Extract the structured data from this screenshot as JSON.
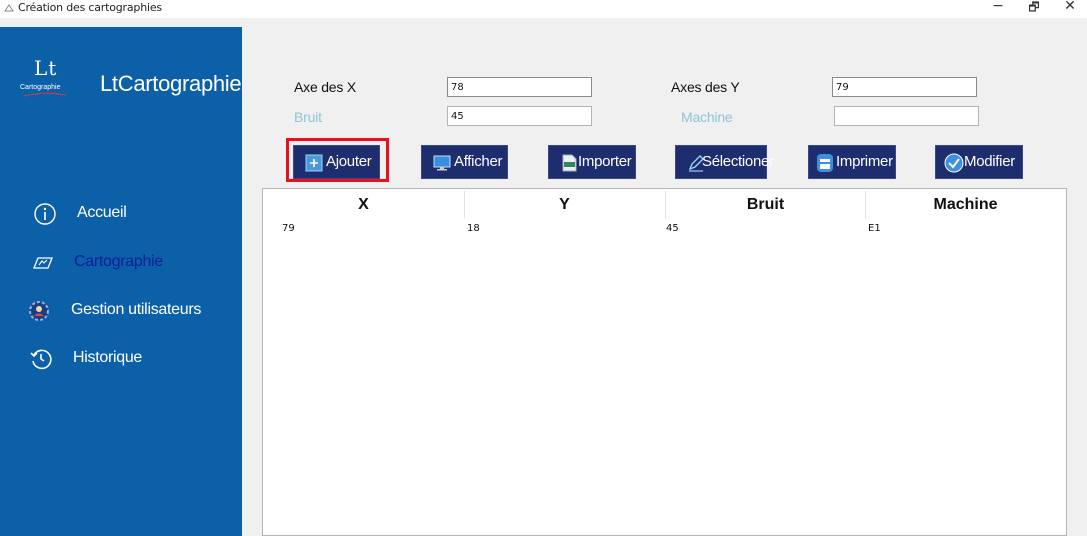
{
  "window": {
    "title": "Création des cartographies",
    "minimize": "−",
    "maximize": "🗗",
    "close": "✕"
  },
  "sidebar": {
    "logo_text": "Lt",
    "logo_subtitle": "Cartographie",
    "brand": "LtCartographie",
    "items": [
      {
        "label": "Accueil",
        "icon": "info-icon",
        "active": false
      },
      {
        "label": "Cartographie",
        "icon": "map-icon",
        "active": true
      },
      {
        "label": "Gestion utilisateurs",
        "icon": "users-gear-icon",
        "active": false
      },
      {
        "label": "Historique",
        "icon": "history-icon",
        "active": false
      }
    ]
  },
  "form": {
    "x_label": "Axe des X",
    "x_value": "78",
    "y_label": "Axes des Y",
    "y_value": "79",
    "noise_label": "Bruit",
    "noise_value": "45",
    "machine_label": "Machine",
    "machine_value": ""
  },
  "toolbar": {
    "add_label": "Ajouter",
    "show_label": "Afficher",
    "import_label": "Importer",
    "select_label": "Sélectioner",
    "print_label": "Imprimer",
    "edit_label": "Modifier"
  },
  "table": {
    "columns": [
      "X",
      "Y",
      "Bruit",
      "Machine"
    ],
    "rows": [
      [
        "79",
        "18",
        "45",
        "E1"
      ]
    ]
  },
  "colors": {
    "sidebar": "#0c60a8",
    "button": "#1d2d6e",
    "highlight": "#e8101a",
    "active_nav": "#0a1f9c"
  }
}
